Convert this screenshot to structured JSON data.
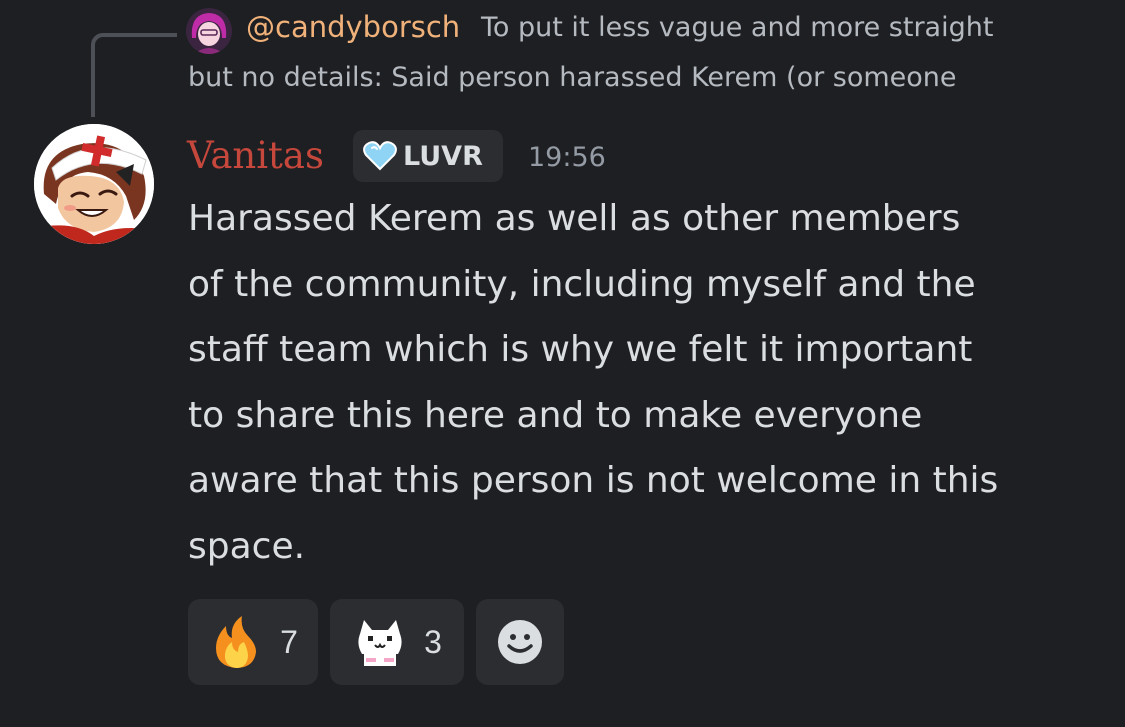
{
  "colors": {
    "background": "#1e1f22",
    "reaction_bg": "#2b2d31",
    "reply_name": "#f0b27a",
    "author_name": "#c6473b",
    "body_text": "#dbdee1",
    "muted_text": "#949ba4"
  },
  "reply": {
    "avatar_icon": "reply-user-avatar",
    "username": "@candyborsch",
    "text_line_1": "To put it less vague and more straight",
    "text_line_2": "but no details:   Said person harassed Kerem (or someone"
  },
  "message": {
    "avatar_icon": "user-avatar",
    "author": "Vanitas",
    "role_tag": {
      "icon": "heart-icon",
      "label": "LUVR"
    },
    "timestamp": "19:56",
    "body_lines": [
      "Harassed Kerem as well as other members",
      "of the community, including myself and the",
      "staff team which is why we felt it important",
      "to share this here and to make everyone",
      "aware that this person is not welcome in this",
      "space."
    ]
  },
  "reactions": [
    {
      "emoji": "fire-emoji",
      "count": "7"
    },
    {
      "emoji": "cat-emoji",
      "count": "3"
    },
    {
      "emoji": "add-reaction-icon"
    }
  ]
}
